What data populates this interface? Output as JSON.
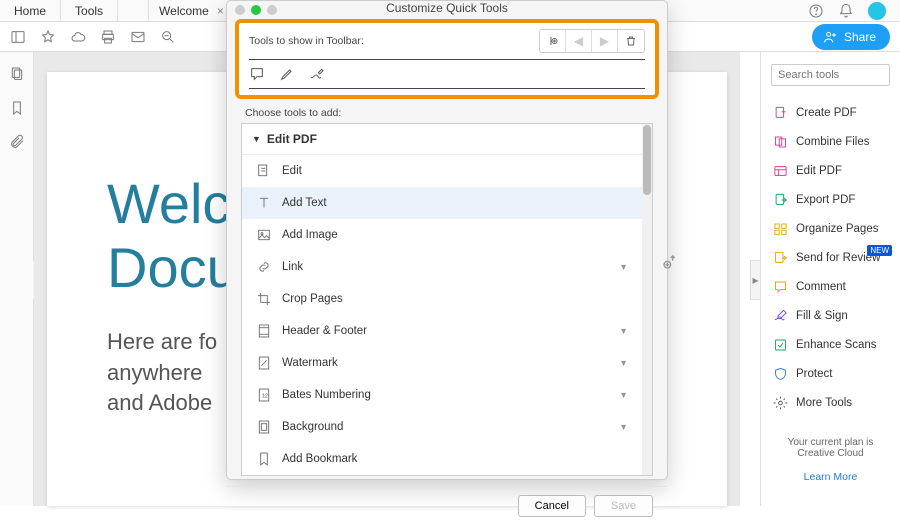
{
  "top_tabs": {
    "home": "Home",
    "tools": "Tools"
  },
  "doc_tab": {
    "label": "Welcome"
  },
  "share": {
    "label": "Share"
  },
  "search": {
    "placeholder": "Search tools"
  },
  "right_tools": [
    {
      "label": "Create PDF",
      "icon": "create-pdf-icon",
      "color": "#d63f8e"
    },
    {
      "label": "Combine Files",
      "icon": "combine-files-icon",
      "color": "#d63f8e"
    },
    {
      "label": "Edit PDF",
      "icon": "edit-pdf-icon",
      "color": "#d63f8e"
    },
    {
      "label": "Export PDF",
      "icon": "export-pdf-icon",
      "color": "#1aa566"
    },
    {
      "label": "Organize Pages",
      "icon": "organize-pages-icon",
      "color": "#e6a50a"
    },
    {
      "label": "Send for Review",
      "icon": "send-review-icon",
      "color": "#e6a50a",
      "badge": "NEW"
    },
    {
      "label": "Comment",
      "icon": "comment-icon",
      "color": "#e6a50a"
    },
    {
      "label": "Fill & Sign",
      "icon": "fill-sign-icon",
      "color": "#7b4cd6"
    },
    {
      "label": "Enhance Scans",
      "icon": "enhance-scans-icon",
      "color": "#1aa566"
    },
    {
      "label": "Protect",
      "icon": "protect-icon",
      "color": "#3b7dd8"
    },
    {
      "label": "More Tools",
      "icon": "more-tools-icon",
      "color": "#555"
    }
  ],
  "plan": {
    "text": "Your current plan is Creative Cloud",
    "learn_more": "Learn More"
  },
  "document": {
    "title_line1": "Welc",
    "title_line2": "Docu",
    "body_line1": "Here are fo",
    "body_line2": "anywhere ",
    "body_line3": "and Adobe"
  },
  "dialog": {
    "title": "Customize Quick Tools",
    "section1_label": "Tools to show in Toolbar:",
    "section2_label": "Choose tools to add:",
    "group": "Edit PDF",
    "items": [
      {
        "label": "Edit",
        "icon": "edit-icon",
        "sub": false
      },
      {
        "label": "Add Text",
        "icon": "add-text-icon",
        "sub": false,
        "selected": true
      },
      {
        "label": "Add Image",
        "icon": "add-image-icon",
        "sub": false
      },
      {
        "label": "Link",
        "icon": "link-icon",
        "sub": true
      },
      {
        "label": "Crop Pages",
        "icon": "crop-pages-icon",
        "sub": false
      },
      {
        "label": "Header & Footer",
        "icon": "header-footer-icon",
        "sub": true
      },
      {
        "label": "Watermark",
        "icon": "watermark-icon",
        "sub": true
      },
      {
        "label": "Bates Numbering",
        "icon": "bates-icon",
        "sub": true
      },
      {
        "label": "Background",
        "icon": "background-icon",
        "sub": true
      },
      {
        "label": "Add Bookmark",
        "icon": "bookmark-icon",
        "sub": false
      }
    ],
    "cancel": "Cancel",
    "save": "Save"
  }
}
